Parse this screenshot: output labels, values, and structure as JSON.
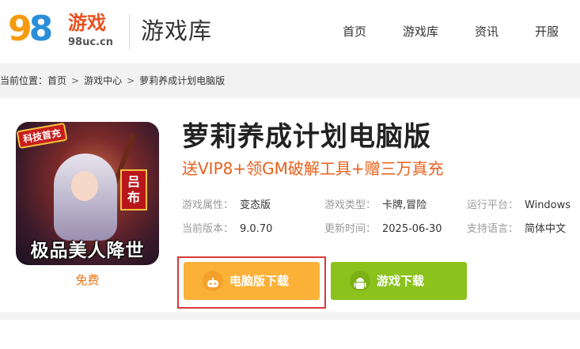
{
  "header": {
    "logo": {
      "num": "98",
      "cn": "游戏",
      "url": "98uc.cn"
    },
    "site_title": "游戏库",
    "nav": [
      "首页",
      "游戏库",
      "资讯",
      "开服"
    ]
  },
  "breadcrumb": {
    "prefix": "当前位置：",
    "items": [
      "首页",
      "游戏中心",
      "萝莉养成计划电脑版"
    ],
    "separator": ">"
  },
  "game": {
    "icon": {
      "tag": "科技首充",
      "name": "吕布",
      "slogan": "极品美人降世"
    },
    "price": "免费",
    "title": "萝莉养成计划电脑版",
    "subtitle": "送VIP8+领GM破解工具+赠三万真充",
    "attributes": [
      {
        "key": "游戏属性：",
        "value": "变态版"
      },
      {
        "key": "游戏类型：",
        "value": "卡牌,冒险"
      },
      {
        "key": "运行平台：",
        "value": "Windows"
      },
      {
        "key": "当前版本：",
        "value": "9.0.70"
      },
      {
        "key": "更新时间：",
        "value": "2025-06-30"
      },
      {
        "key": "支持语言：",
        "value": "简体中文"
      }
    ],
    "buttons": {
      "pc_download": "电脑版下载",
      "game_download": "游戏下载"
    }
  },
  "colors": {
    "accent_orange": "#e8601c",
    "pc_button": "#fbb138",
    "game_button": "#8cc21c",
    "highlight_border": "#d83a3a"
  }
}
